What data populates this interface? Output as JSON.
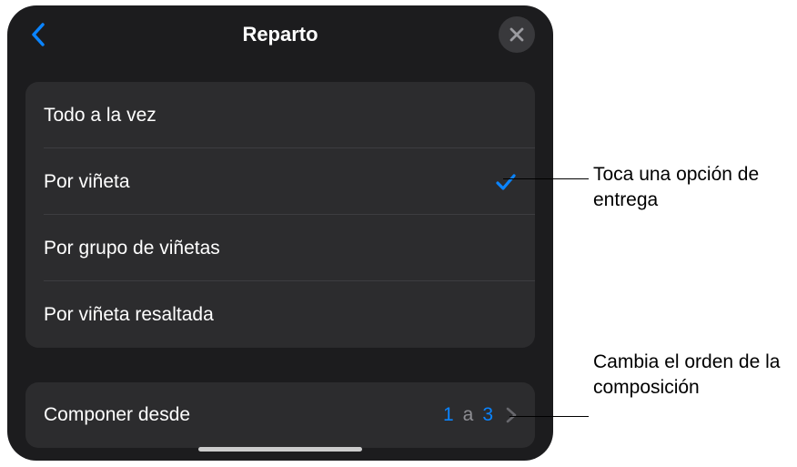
{
  "header": {
    "title": "Reparto"
  },
  "options": {
    "items": [
      {
        "label": "Todo a la vez",
        "selected": false
      },
      {
        "label": "Por viñeta",
        "selected": true
      },
      {
        "label": "Por grupo de viñetas",
        "selected": false
      },
      {
        "label": "Por viñeta resaltada",
        "selected": false
      }
    ]
  },
  "compose": {
    "label": "Componer desde",
    "from": "1",
    "separator": "a",
    "to": "3"
  },
  "callouts": {
    "delivery": "Toca una opción de entrega",
    "order": "Cambia el orden de la composición"
  },
  "colors": {
    "accent": "#0a84ff",
    "panel_bg": "#1c1c1e",
    "group_bg": "#2c2c2e"
  }
}
